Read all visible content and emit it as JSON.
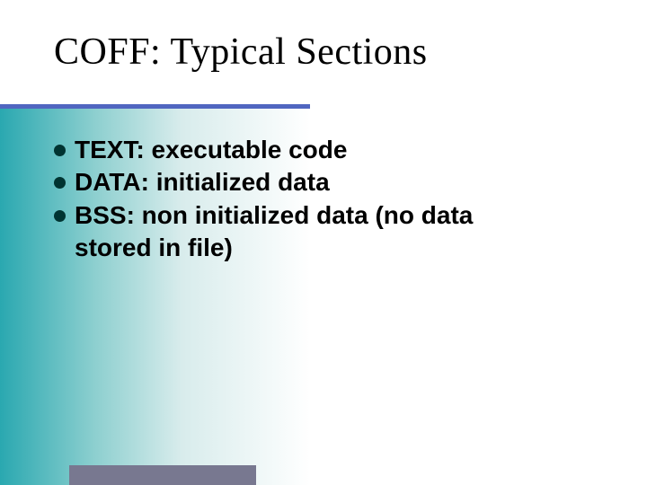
{
  "title": "COFF: Typical Sections",
  "bullets": [
    {
      "text": "TEXT: executable code"
    },
    {
      "text": "DATA: initialized data"
    },
    {
      "text": "BSS: non initialized data (no data",
      "continuation": "stored in file)"
    }
  ]
}
